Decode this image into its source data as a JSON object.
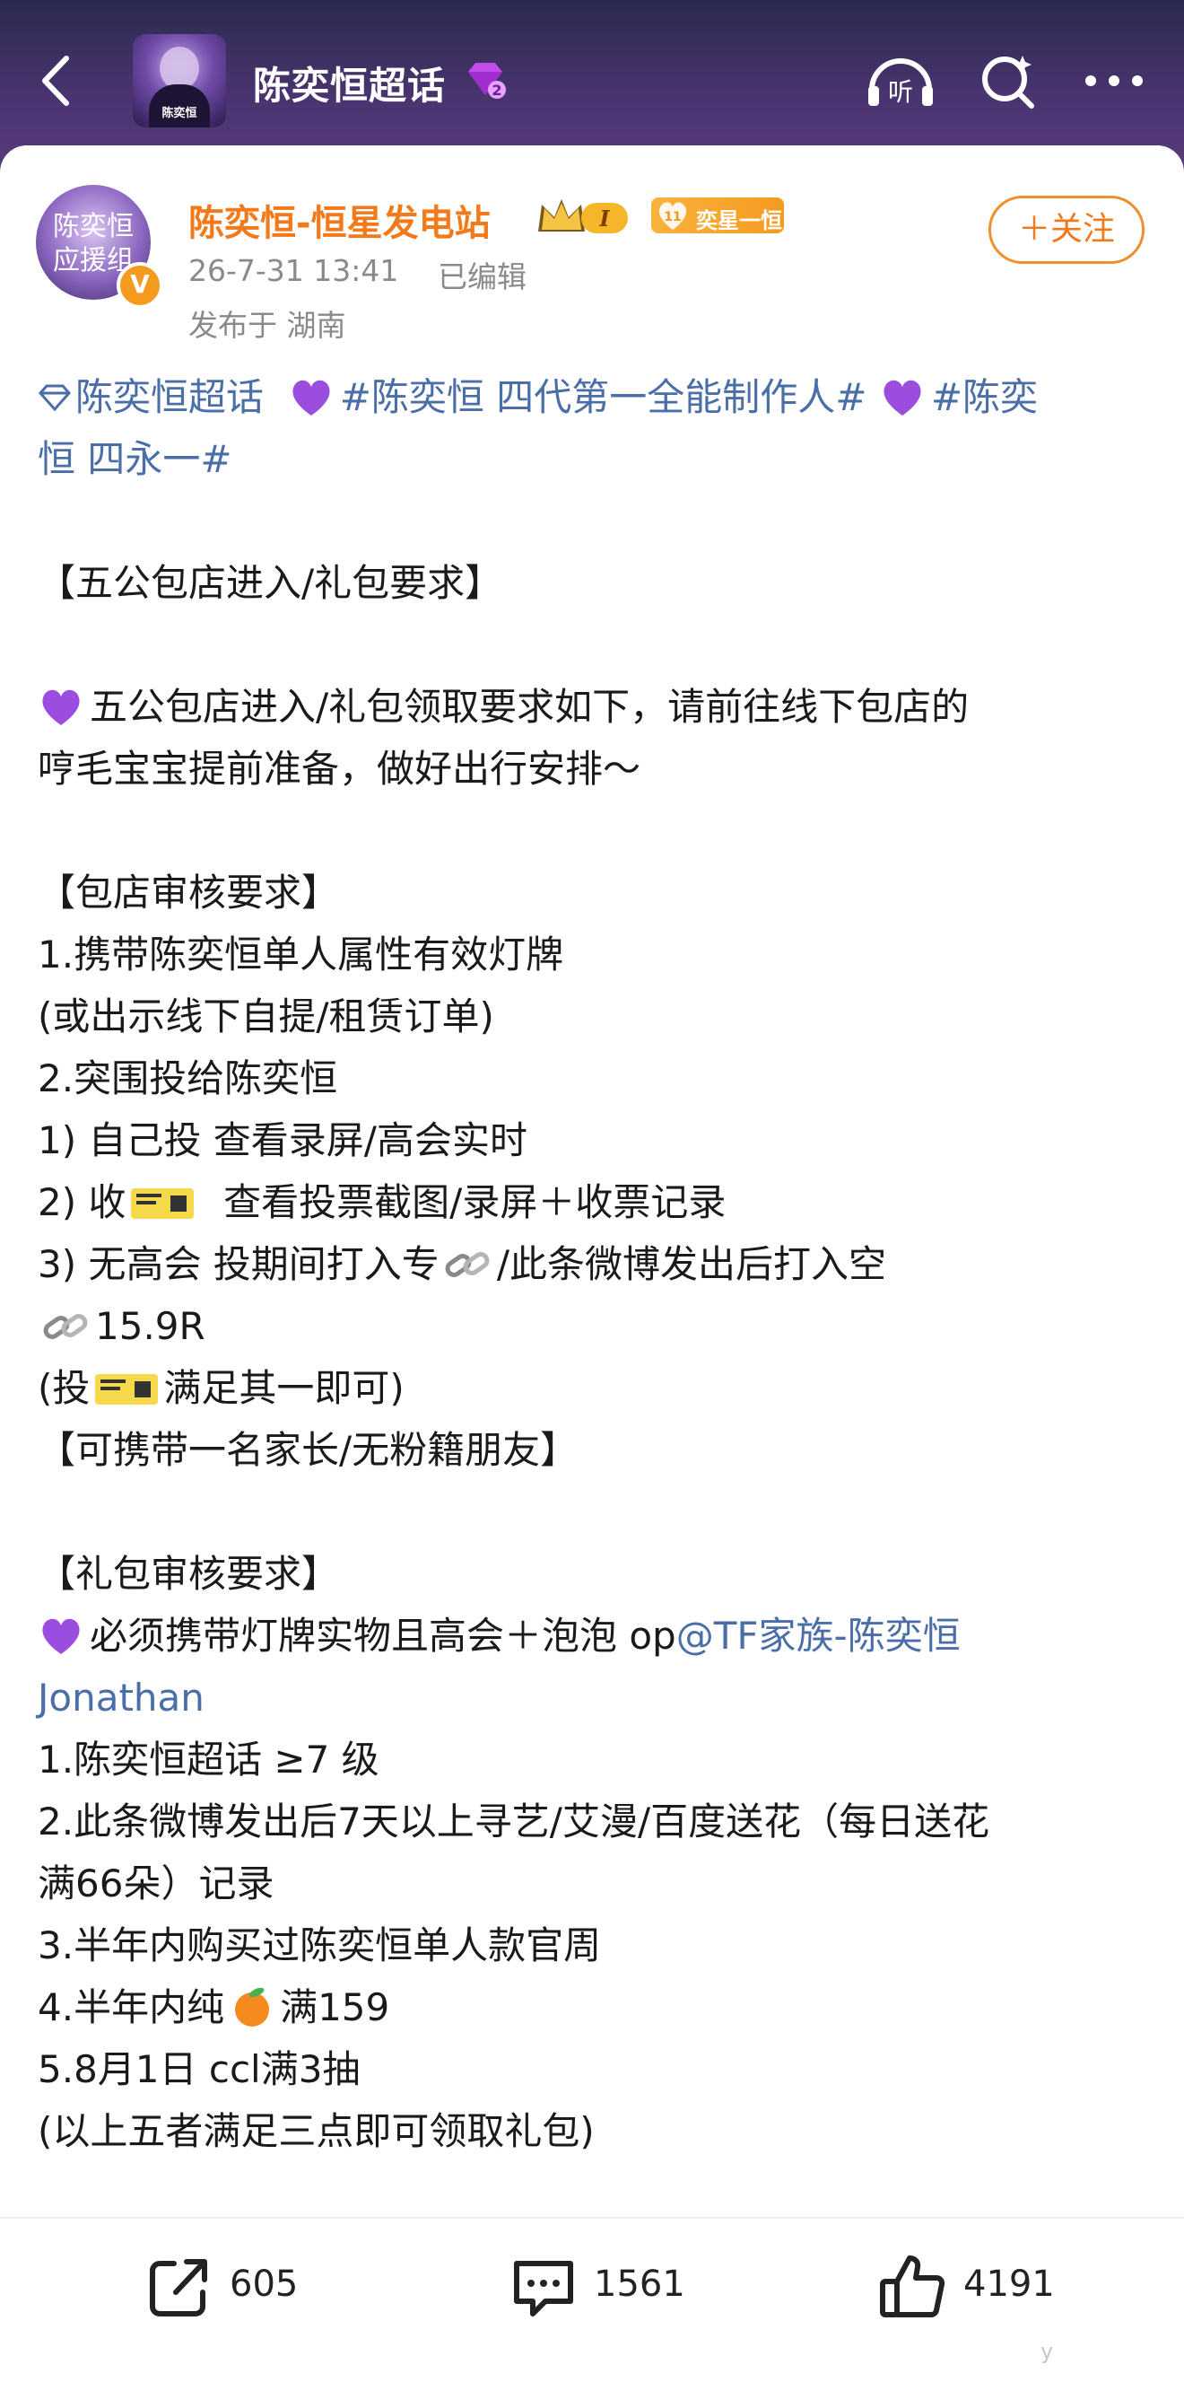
{
  "header": {
    "topic_title": "陈奕恒超话",
    "topic_level_badge": "2",
    "cover_text": "陈奕恒",
    "icons": [
      "back-icon",
      "listen-icon",
      "search-icon",
      "more-icon"
    ],
    "listen_label": "听"
  },
  "post": {
    "author": "陈奕恒-恒星发电站",
    "avatar_text": "陈奕恒 应援组",
    "crown_level": "I",
    "fan_badge_level": "11",
    "fan_badge_text": "奕星一恒",
    "follow_label": "＋关注",
    "timestamp": "26-7-31 13:41",
    "edited_label": "已编辑",
    "location": "发布于 湖南",
    "tags_line1": {
      "supertopic": "陈奕恒超话",
      "tag1": "#陈奕恒 四代第一全能制作人#",
      "tag2_start": "#陈奕"
    },
    "tags_line2": "恒 四永一#",
    "section_title": "【五公包店进入/礼包要求】",
    "intro_line1": "五公包店进入/礼包领取要求如下，请前往线下包店的",
    "intro_line2": "哼毛宝宝提前准备，做好出行安排～",
    "audit_title": "【包店审核要求】",
    "audit_1": "1.携带陈奕恒单人属性有效灯牌",
    "audit_1b": "(或出示线下自提/租赁订单)",
    "audit_2": "2.突围投给陈奕恒",
    "audit_2a": "1) 自己投 查看录屏/高会实时",
    "audit_2b_pre": "2) 收",
    "audit_2b_post": "查看投票截图/录屏＋收票记录",
    "audit_2c_pre": "3) 无高会 投期间打入专",
    "audit_2c_post": "/此条微博发出后打入空",
    "audit_2c_amount": "15.9R",
    "audit_2d_pre": "(投",
    "audit_2d_post": "满足其一即可)",
    "companion": "【可携带一名家长/无粉籍朋友】",
    "gift_title": "【礼包审核要求】",
    "gift_req_pre": "必须携带灯牌实物且高会＋泡泡 op",
    "gift_req_mention": "@TF家族-陈奕恒",
    "gift_req_mention2": "Jonathan",
    "gift_1": "1.陈奕恒超话 ≥7 级",
    "gift_2": "2.此条微博发出后7天以上寻艺/艾漫/百度送花（每日送花",
    "gift_2b": "满66朵）记录",
    "gift_3": "3.半年内购买过陈奕恒单人款官周",
    "gift_4_pre": "4.半年内纯",
    "gift_4_post": "满159",
    "gift_5": "5.8月1日 ccl满3抽",
    "gift_note": "(以上五者满足三点即可领取礼包)"
  },
  "actions": {
    "reposts": "605",
    "comments": "1561",
    "likes": "4191"
  },
  "watermark": "y",
  "colors": {
    "author": "#f27a1a",
    "link_blue": "#4a6ea8",
    "header_bg": "#4a3470",
    "heart_purple": "#9b4de0"
  }
}
